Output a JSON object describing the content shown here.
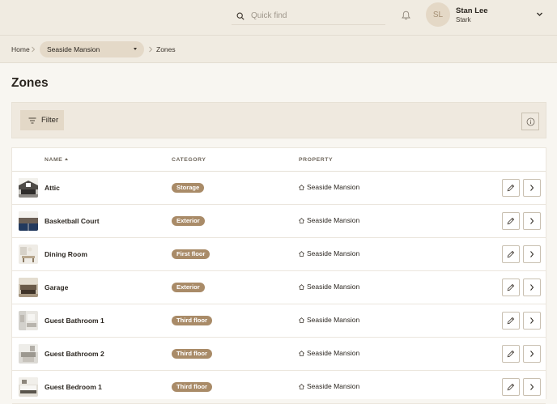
{
  "header": {
    "search_placeholder": "Quick find",
    "user": {
      "initials": "SL",
      "name": "Stan Lee",
      "org": "Stark"
    }
  },
  "breadcrumb": {
    "home": "Home",
    "property": "Seaside Mansion",
    "current": "Zones"
  },
  "page": {
    "title": "Zones"
  },
  "toolbar": {
    "filter_label": "Filter"
  },
  "table": {
    "columns": {
      "name": "NAME",
      "category": "CATEGORY",
      "property": "PROPERTY"
    },
    "rows": [
      {
        "name": "Attic",
        "category": "Storage",
        "property": "Seaside Mansion"
      },
      {
        "name": "Basketball Court",
        "category": "Exterior",
        "property": "Seaside Mansion"
      },
      {
        "name": "Dining Room",
        "category": "First floor",
        "property": "Seaside Mansion"
      },
      {
        "name": "Garage",
        "category": "Exterior",
        "property": "Seaside Mansion"
      },
      {
        "name": "Guest Bathroom 1",
        "category": "Third floor",
        "property": "Seaside Mansion"
      },
      {
        "name": "Guest Bathroom 2",
        "category": "Third floor",
        "property": "Seaside Mansion"
      },
      {
        "name": "Guest Bedroom 1",
        "category": "Third floor",
        "property": "Seaside Mansion"
      }
    ]
  },
  "icons": {
    "search": "search-icon",
    "bell": "bell-icon",
    "chevron": "chevron-down-icon",
    "filter": "filter-icon",
    "info": "info-icon",
    "home": "home-icon",
    "edit": "pencil-icon",
    "go": "chevron-right-icon"
  },
  "colors": {
    "accent_badge": "#a98b68",
    "header_bg": "#f0ebe1",
    "page_bg": "#f8f6f1"
  }
}
